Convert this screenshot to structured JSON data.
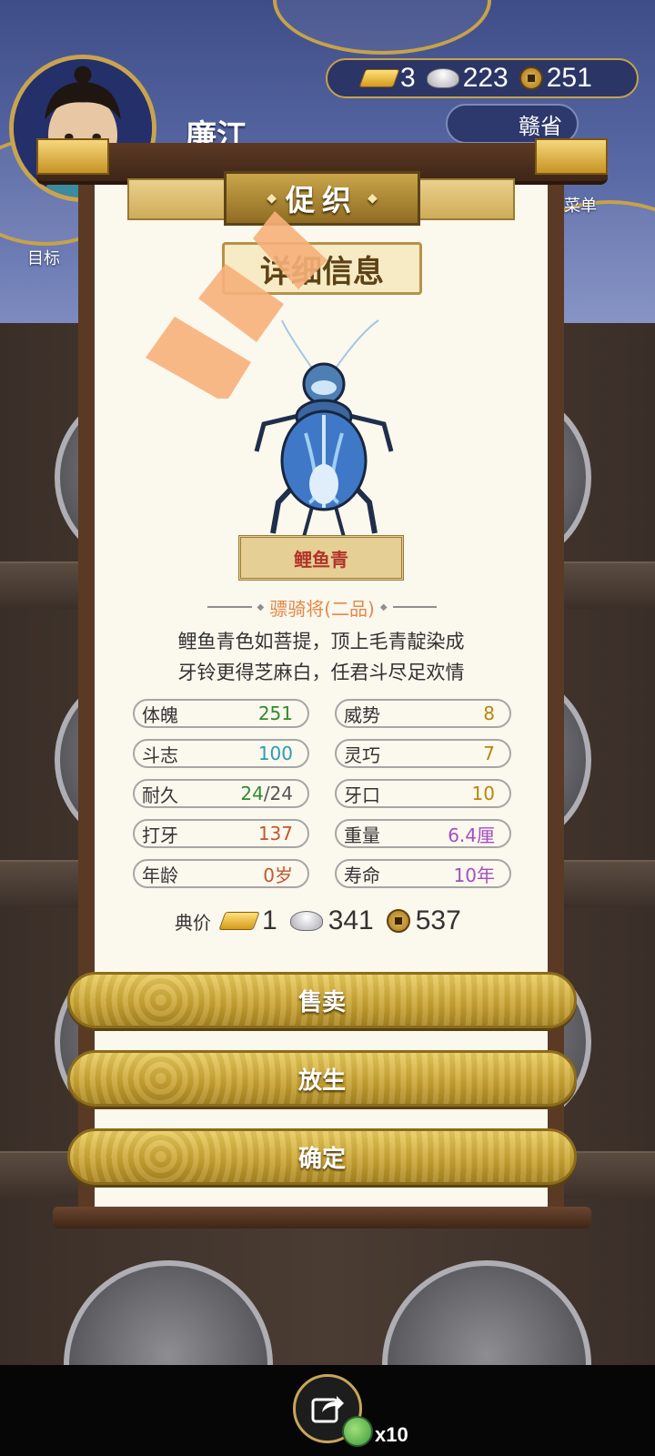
{
  "player": {
    "name": "廉江"
  },
  "currency": {
    "gold": "3",
    "silver": "223",
    "copper": "251"
  },
  "region": {
    "label": "赣省"
  },
  "side": {
    "goal_label": "目标",
    "menu_label": "菜单"
  },
  "dialog": {
    "title": "促织",
    "subtitle": "详细信息",
    "cricket_name": "鲤鱼青",
    "rank": "骠骑将(二品)",
    "description": [
      "鲤鱼青色如菩提，顶上毛青靛染成",
      "牙铃更得芝麻白，任君斗尽足欢情"
    ],
    "stats": [
      {
        "label": "体魄",
        "value": "251",
        "color": "#2e8b2e"
      },
      {
        "label": "威势",
        "value": "8",
        "color": "#b8860b"
      },
      {
        "label": "斗志",
        "value": "100",
        "color": "#2a9db4"
      },
      {
        "label": "灵巧",
        "value": "7",
        "color": "#b8860b"
      },
      {
        "label": "耐久",
        "value_main": "24",
        "value_rest": "/24",
        "color": "#2e8b2e"
      },
      {
        "label": "牙口",
        "value": "10",
        "color": "#b8860b"
      },
      {
        "label": "打牙",
        "value": "137",
        "color": "#c0582e"
      },
      {
        "label": "重量",
        "value": "6.4厘",
        "color": "#a34fc0"
      },
      {
        "label": "年龄",
        "value": "0岁",
        "color": "#c0582e"
      },
      {
        "label": "寿命",
        "value": "10年",
        "color": "#a34fc0"
      }
    ],
    "price": {
      "label": "典价",
      "gold": "1",
      "silver": "341",
      "copper": "537"
    },
    "buttons": {
      "sell": "售卖",
      "release": "放生",
      "confirm": "确定"
    }
  },
  "share": {
    "count": "x10"
  },
  "colors": {
    "accent_gold": "#c9a332",
    "frame_wood": "#5a3a25",
    "paper": "#fbf8ee"
  }
}
